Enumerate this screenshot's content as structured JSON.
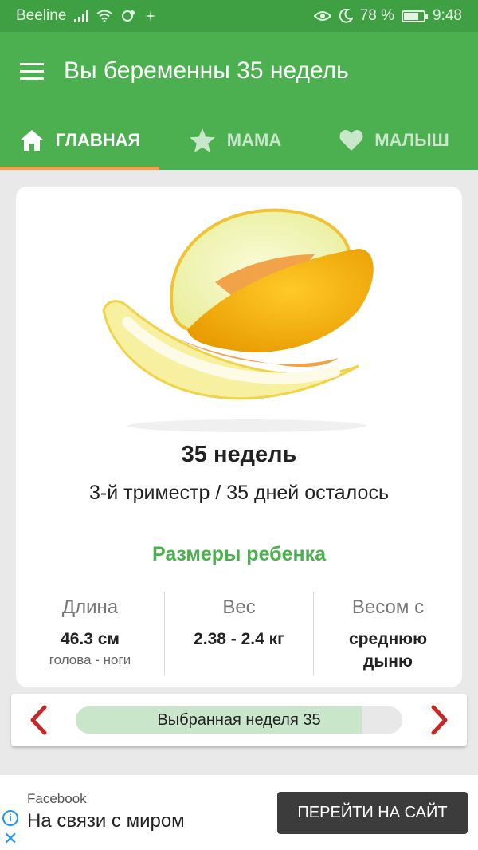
{
  "status_bar": {
    "carrier": "Beeline",
    "battery_text": "78 %",
    "battery_level": 0.78,
    "time": "9:48",
    "left_icons": [
      "signal-icon",
      "wifi-icon",
      "sync-icon",
      "sparkle-icon"
    ],
    "right_icons": [
      "eye-icon",
      "moon-icon",
      "battery-icon"
    ]
  },
  "app_bar": {
    "menu_icon": "hamburger-menu-icon",
    "title": "Вы беременны 35 недель"
  },
  "tabs": [
    {
      "label": "ГЛАВНАЯ",
      "icon": "home-icon",
      "active": true
    },
    {
      "label": "МАМА",
      "icon": "star-icon",
      "active": false
    },
    {
      "label": "МАЛЫШ",
      "icon": "heart-icon",
      "active": false
    }
  ],
  "week_card": {
    "image": "melon-image",
    "title": "35 недель",
    "subtitle": "3-й триместр / 35 дней осталось",
    "sizes_title": "Размеры ребенка",
    "metrics": [
      {
        "label": "Длина",
        "value": "46.3 см",
        "sub": "голова - ноги"
      },
      {
        "label": "Вес",
        "value": "2.38 - 2.4 кг",
        "sub": ""
      },
      {
        "label": "Весом с",
        "value": "среднюю дыню",
        "sub": ""
      }
    ]
  },
  "week_selector": {
    "label": "Выбранная неделя 35",
    "progress": 0.875,
    "prev_icon": "chevron-left-icon",
    "next_icon": "chevron-right-icon"
  },
  "ad": {
    "source": "Facebook",
    "headline": "На связи с миром",
    "cta_label": "ПЕРЕЙТИ НА САЙТ",
    "info_icon": "info-icon",
    "close_icon": "close-icon"
  },
  "colors": {
    "status_bar": "#3ea043",
    "primary": "#4caf50",
    "tab_indicator": "#ff9f45",
    "arrow": "#c62828",
    "progress_fill": "#c9e6cb",
    "cta_background": "#3c3c3c",
    "ad_icon": "#2196f3"
  }
}
